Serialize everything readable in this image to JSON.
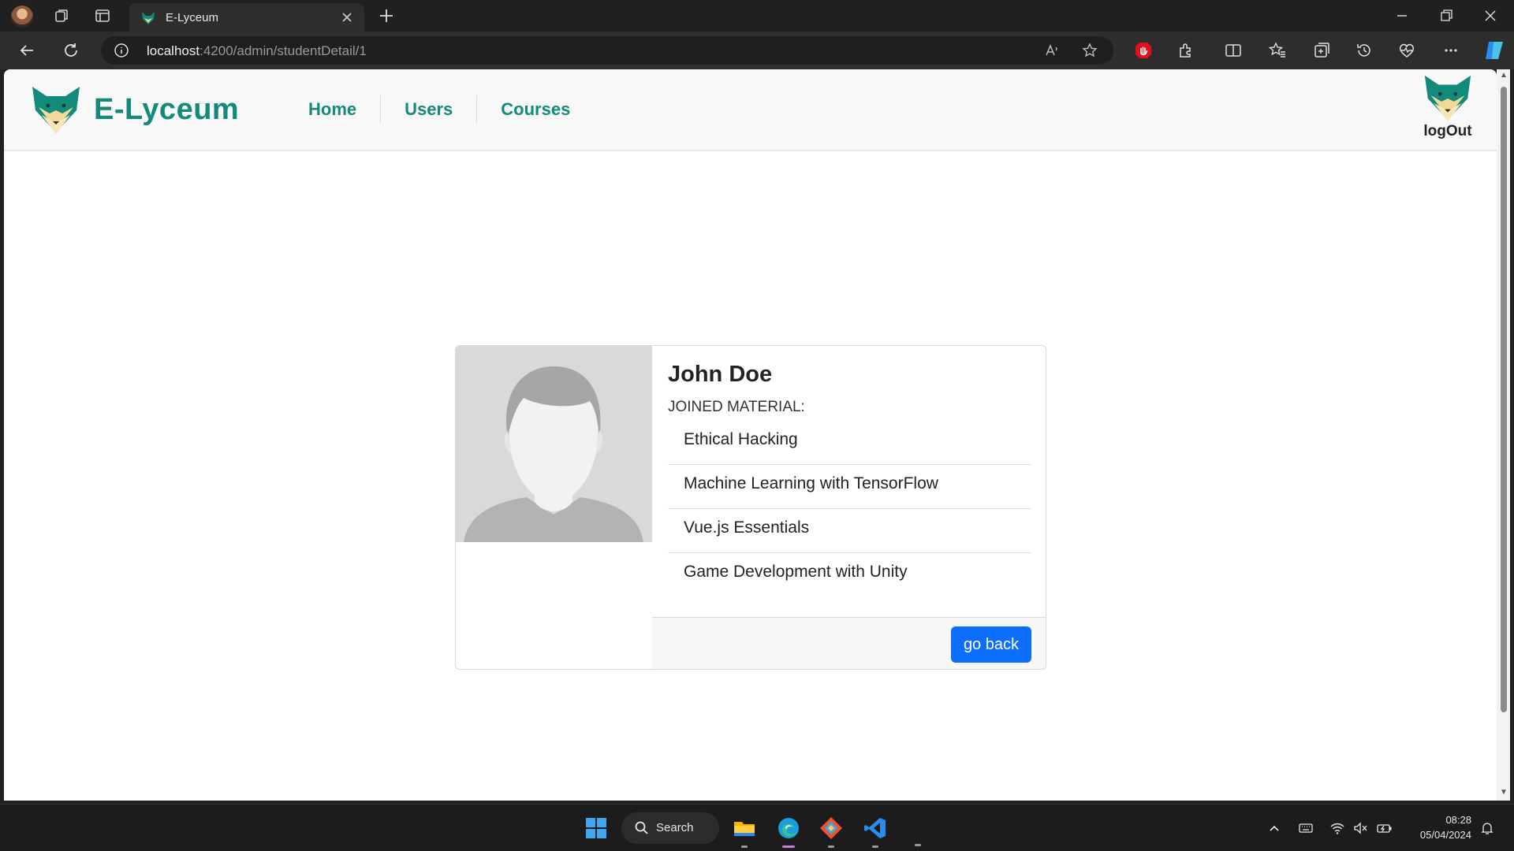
{
  "browser": {
    "tab_title": "E-Lyceum",
    "url_host": "localhost",
    "url_path": ":4200/admin/studentDetail/1"
  },
  "header": {
    "brand": "E-Lyceum",
    "nav": [
      "Home",
      "Users",
      "Courses"
    ],
    "logout_label": "logOut"
  },
  "student": {
    "name": "John Doe",
    "joined_label": "JOINED MATERIAL:",
    "materials": [
      "Ethical Hacking",
      "Machine Learning with TensorFlow",
      "Vue.js Essentials",
      "Game Development with Unity"
    ],
    "go_back_label": "go back"
  },
  "taskbar": {
    "search_label": "Search",
    "time": "08:28",
    "date": "05/04/2024"
  },
  "colors": {
    "brand": "#138a7a",
    "primary_button": "#0d6efd"
  }
}
